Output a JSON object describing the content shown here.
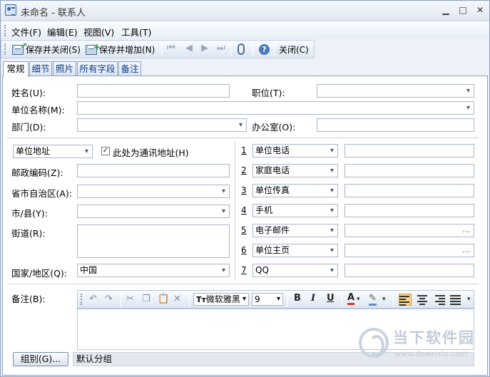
{
  "window": {
    "title": "未命名 - 联系人",
    "minimize": "▁",
    "maximize": "□",
    "close": "✕"
  },
  "menu": [
    {
      "label": "文件(F)"
    },
    {
      "label": "编辑(E)"
    },
    {
      "label": "视图(V)"
    },
    {
      "label": "工具(T)"
    }
  ],
  "toolbar": {
    "save_close": "保存并关闭(S)",
    "save_add": "保存并增加(N)",
    "close": "关闭(C)",
    "nav_first": "⏮",
    "nav_prev": "◀",
    "nav_next": "▶",
    "nav_last": "⏭",
    "help": "?"
  },
  "tabs": [
    {
      "label": "常规",
      "active": true
    },
    {
      "label": "细节"
    },
    {
      "label": "照片"
    },
    {
      "label": "所有字段"
    },
    {
      "label": "备注"
    }
  ],
  "general": {
    "name_label": "姓名(U):",
    "name_value": "",
    "position_label": "职位(T):",
    "position_value": "",
    "company_label": "单位名称(M):",
    "company_value": "",
    "dept_label": "部门(D):",
    "dept_value": "",
    "office_label": "办公室(O):",
    "office_value": ""
  },
  "address": {
    "type": "单位地址",
    "mailing_checkbox_label": "此处为通讯地址(H)",
    "mailing_checked": "✓",
    "postal_label": "邮政编码(Z):",
    "postal_value": "",
    "province_label": "省市自治区(A):",
    "province_value": "",
    "city_label": "市/县(Y):",
    "city_value": "",
    "street_label": "街道(R):",
    "street_value": "",
    "country_label": "国家/地区(Q):",
    "country_value": "中国"
  },
  "phones": [
    {
      "num": "1",
      "type": "单位电话",
      "value": ""
    },
    {
      "num": "2",
      "type": "家庭电话",
      "value": ""
    },
    {
      "num": "3",
      "type": "单位传真",
      "value": ""
    },
    {
      "num": "4",
      "type": "手机",
      "value": ""
    },
    {
      "num": "5",
      "type": "电子邮件",
      "value": ""
    },
    {
      "num": "6",
      "type": "单位主页",
      "value": ""
    },
    {
      "num": "7",
      "type": "QQ",
      "value": ""
    }
  ],
  "notes": {
    "label": "备注(B):",
    "font": "微软雅黑",
    "font_icon": "Tт",
    "size": "9",
    "bold": "B",
    "italic": "I",
    "underline": "U",
    "font_color": "A",
    "body": ""
  },
  "group": {
    "button": "组别(G)...",
    "value": "默认分组"
  },
  "watermark": {
    "text": "当下软件园",
    "url": "www.downxia.com"
  }
}
